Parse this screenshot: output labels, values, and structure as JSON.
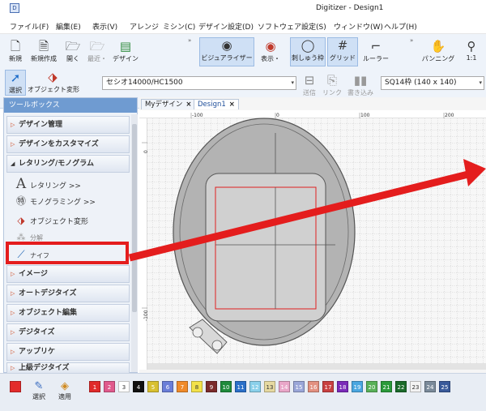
{
  "app": {
    "icon_label": "D",
    "title": "Digitizer - Design1"
  },
  "menu": [
    "ファイル(F)",
    "編集(E)",
    "表示(V)",
    "アレンジ",
    "ミシン(C)",
    "デザイン設定(D)",
    "ソフトウェア設定(S)",
    "ウィンドウ(W)",
    "ヘルプ(H)"
  ],
  "toolbar": {
    "new_label": "新規",
    "new_create_label": "新規作成",
    "open_label": "開く",
    "recent_label": "最近・",
    "design_label": "デザイン",
    "visualizer_label": "ビジュアライザー",
    "display_label": "表示・",
    "hoop_label": "刺しゅう枠",
    "grid_label": "グリッド",
    "ruler_label": "ルーラー",
    "panning_label": "パンニング",
    "zoom_label": "1:1",
    "select_label": "選択",
    "transform_label": "オブジェクト変形",
    "machine_combo": "セシオ14000/HC1500",
    "send_label": "送信",
    "link_label": "リンク",
    "write_label": "書き込み",
    "hoop_combo": "SQ14枠 (140 x 140)"
  },
  "toolbox": {
    "header": "ツールボックス",
    "sections": {
      "design_manage": "デザイン管理",
      "customize": "デザインをカスタマイズ",
      "lettering": "レタリング/モノグラム",
      "image": "イメージ",
      "auto_digitize": "オートデジタイズ",
      "object_edit": "オブジェクト編集",
      "digitize": "デジタイズ",
      "applique": "アップリケ",
      "advanced_digitize": "上級デジタイズ"
    },
    "tools": {
      "lettering": "レタリング >>",
      "monogram": "モノグラミング >>",
      "object_transform": "オブジェクト変形",
      "split": "分解",
      "knife": "ナイフ"
    }
  },
  "tabs": {
    "my_design": "Myデザイン",
    "design1": "Design1",
    "close": "×"
  },
  "ruler": {
    "top_ticks": [
      "-100",
      "0",
      "100",
      "200"
    ],
    "left_ticks": [
      "0",
      "-100"
    ]
  },
  "statusbar": {
    "select_label": "選択",
    "apply_label": "適用",
    "swatch_numbers": [
      "1",
      "2",
      "3",
      "4",
      "5",
      "6",
      "7",
      "8",
      "9",
      "10",
      "11",
      "12",
      "13",
      "14",
      "15",
      "16",
      "17",
      "18",
      "19",
      "20",
      "21",
      "22",
      "23",
      "24",
      "25"
    ]
  },
  "colors": {
    "accent_red": "#e41d1d",
    "toolbox_header": "#6f9bd1",
    "hoop_gray": "#b8b8b8"
  }
}
